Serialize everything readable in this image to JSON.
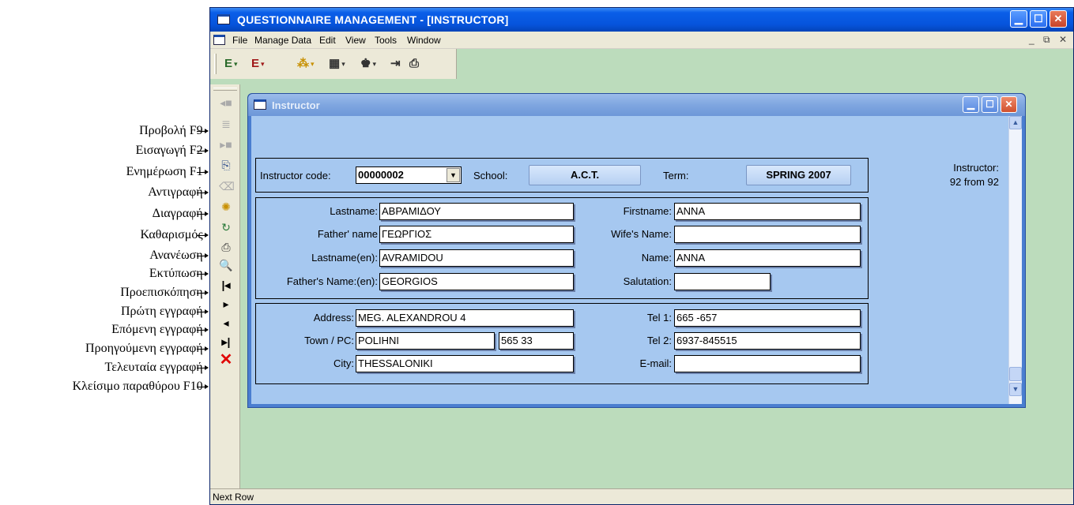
{
  "annotations": [
    "Προβολή F9-",
    "Εισαγωγή F2-",
    "Ενημέρωση F1-",
    "Αντιγραφή-",
    "Διαγραφή-",
    "Καθαρισμός-",
    "Ανανέωση-",
    "Εκτύπωση-",
    "Προεπισκόπηση-",
    "Πρώτη εγγραφή-",
    "Επόμενη εγγραφή-",
    "Προηγούμενη εγγραφή-",
    "Τελευταία εγγραφή-",
    "Κλείσιμο παραθύρου F10-"
  ],
  "app": {
    "title": "QUESTIONNAIRE MANAGEMENT - [INSTRUCTOR]",
    "menu": [
      "File",
      "Manage Data",
      "Edit",
      "View",
      "Tools",
      "Window"
    ],
    "status": "Next Row"
  },
  "child": {
    "title": "Instructor",
    "counter_label": "Instructor:",
    "counter_value": "92 from 92"
  },
  "header": {
    "instructor_code_label": "Instructor code:",
    "instructor_code": "00000002",
    "school_label": "School:",
    "school": "A.C.T.",
    "term_label": "Term:",
    "term": "SPRING 2007"
  },
  "personal": {
    "lastname_label": "Lastname:",
    "lastname": "ΑΒΡΑΜΙΔΟΥ",
    "firstname_label": "Firstname:",
    "firstname": "ΑΝΝΑ",
    "fathername_label": "Father' name",
    "fathername": "ΓΕΩΡΓΙΟΣ",
    "wifename_label": "Wife's Name:",
    "wifename": "",
    "lastname_en_label": "Lastname(en):",
    "lastname_en": "AVRAMIDOU",
    "name_label": "Name:",
    "name": "ANNA",
    "fathername_en_label": "Father's Name:(en):",
    "fathername_en": "GEORGIOS",
    "salutation_label": "Salutation:",
    "salutation": ""
  },
  "contact": {
    "address_label": "Address:",
    "address": "MEG. ALEXANDROU 4",
    "tel1_label": "Tel 1:",
    "tel1": "665 -657",
    "town_label": "Town / PC:",
    "town": "POLIHNI",
    "postcode": "565 33",
    "tel2_label": "Tel 2:",
    "tel2": "6937-845515",
    "city_label": "City:",
    "city": "THESSALONIKI",
    "email_label": "E-mail:",
    "email": ""
  }
}
